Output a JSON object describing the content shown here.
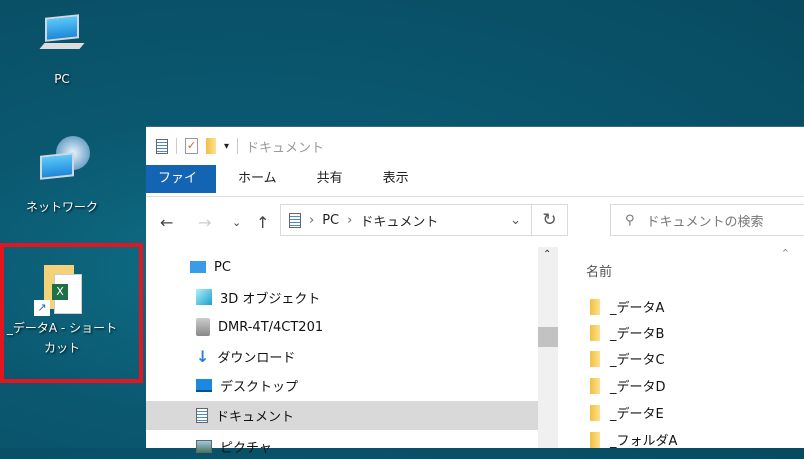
{
  "desktop": {
    "icons": [
      {
        "label": "PC",
        "icon": "pc-icon"
      },
      {
        "label": "ネットワーク",
        "icon": "network-icon"
      },
      {
        "label": "_データA - ショートカット",
        "icon": "excel-shortcut-icon"
      }
    ]
  },
  "window": {
    "title": "ドキュメント",
    "ribbon_tabs": [
      "ファイル",
      "ホーム",
      "共有",
      "表示"
    ],
    "accent": "#1464b4",
    "address": {
      "crumbs": [
        "PC",
        "ドキュメント"
      ]
    },
    "search": {
      "placeholder": "ドキュメントの検索"
    },
    "nav_pane": [
      {
        "label": "PC",
        "icon": "pc-icon"
      },
      {
        "label": "3D オブジェクト",
        "icon": "3d-objects-icon"
      },
      {
        "label": "DMR-4T/4CT201",
        "icon": "media-device-icon"
      },
      {
        "label": "ダウンロード",
        "icon": "download-icon"
      },
      {
        "label": "デスクトップ",
        "icon": "desktop-icon"
      },
      {
        "label": "ドキュメント",
        "icon": "documents-icon",
        "selected": true
      },
      {
        "label": "ピクチャ",
        "icon": "pictures-icon"
      }
    ],
    "list": {
      "column": "名前",
      "items": [
        "_データA",
        "_データB",
        "_データC",
        "_データD",
        "_データE",
        "_フォルダA"
      ]
    }
  },
  "selection_color": "#e3161f"
}
